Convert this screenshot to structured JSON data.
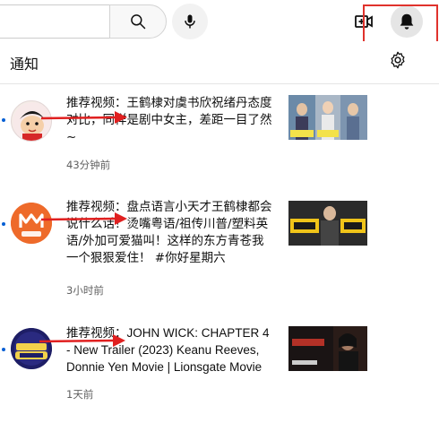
{
  "header": {
    "search_icon": "search-icon",
    "mic_icon": "mic-icon",
    "create_icon": "video-create-icon",
    "bell_icon": "bell-icon"
  },
  "panel": {
    "title": "通知",
    "settings_icon": "gear-icon"
  },
  "notifications": [
    {
      "text": "推荐视频：王鹤棣对虞书欣祝绪丹态度对比，同样是剧中女主，差距一目了然~",
      "time": "43分钟前",
      "avatar": "crayon-shinchan-avatar"
    },
    {
      "text": "推荐视频：盘点语言小天才王鹤棣都会说什么话！烫嘴粤语/祖传川普/塑料英语/外加可爱猫叫！这样的东方青苍我一个狠狠爱住！ #你好星期六",
      "time": "3小时前",
      "avatar": "mango-idol-avatar"
    },
    {
      "text": "推荐视频：JOHN WICK: CHAPTER 4 - New Trailer (2023) Keanu Reeves, Donnie Yen Movie | Lionsgate Movie",
      "time": "1天前",
      "avatar": "screen-culture-avatar"
    }
  ],
  "colors": {
    "accent_blue": "#065fd4",
    "highlight_red": "#e0322c",
    "annotation_arrow": "#e02020"
  }
}
